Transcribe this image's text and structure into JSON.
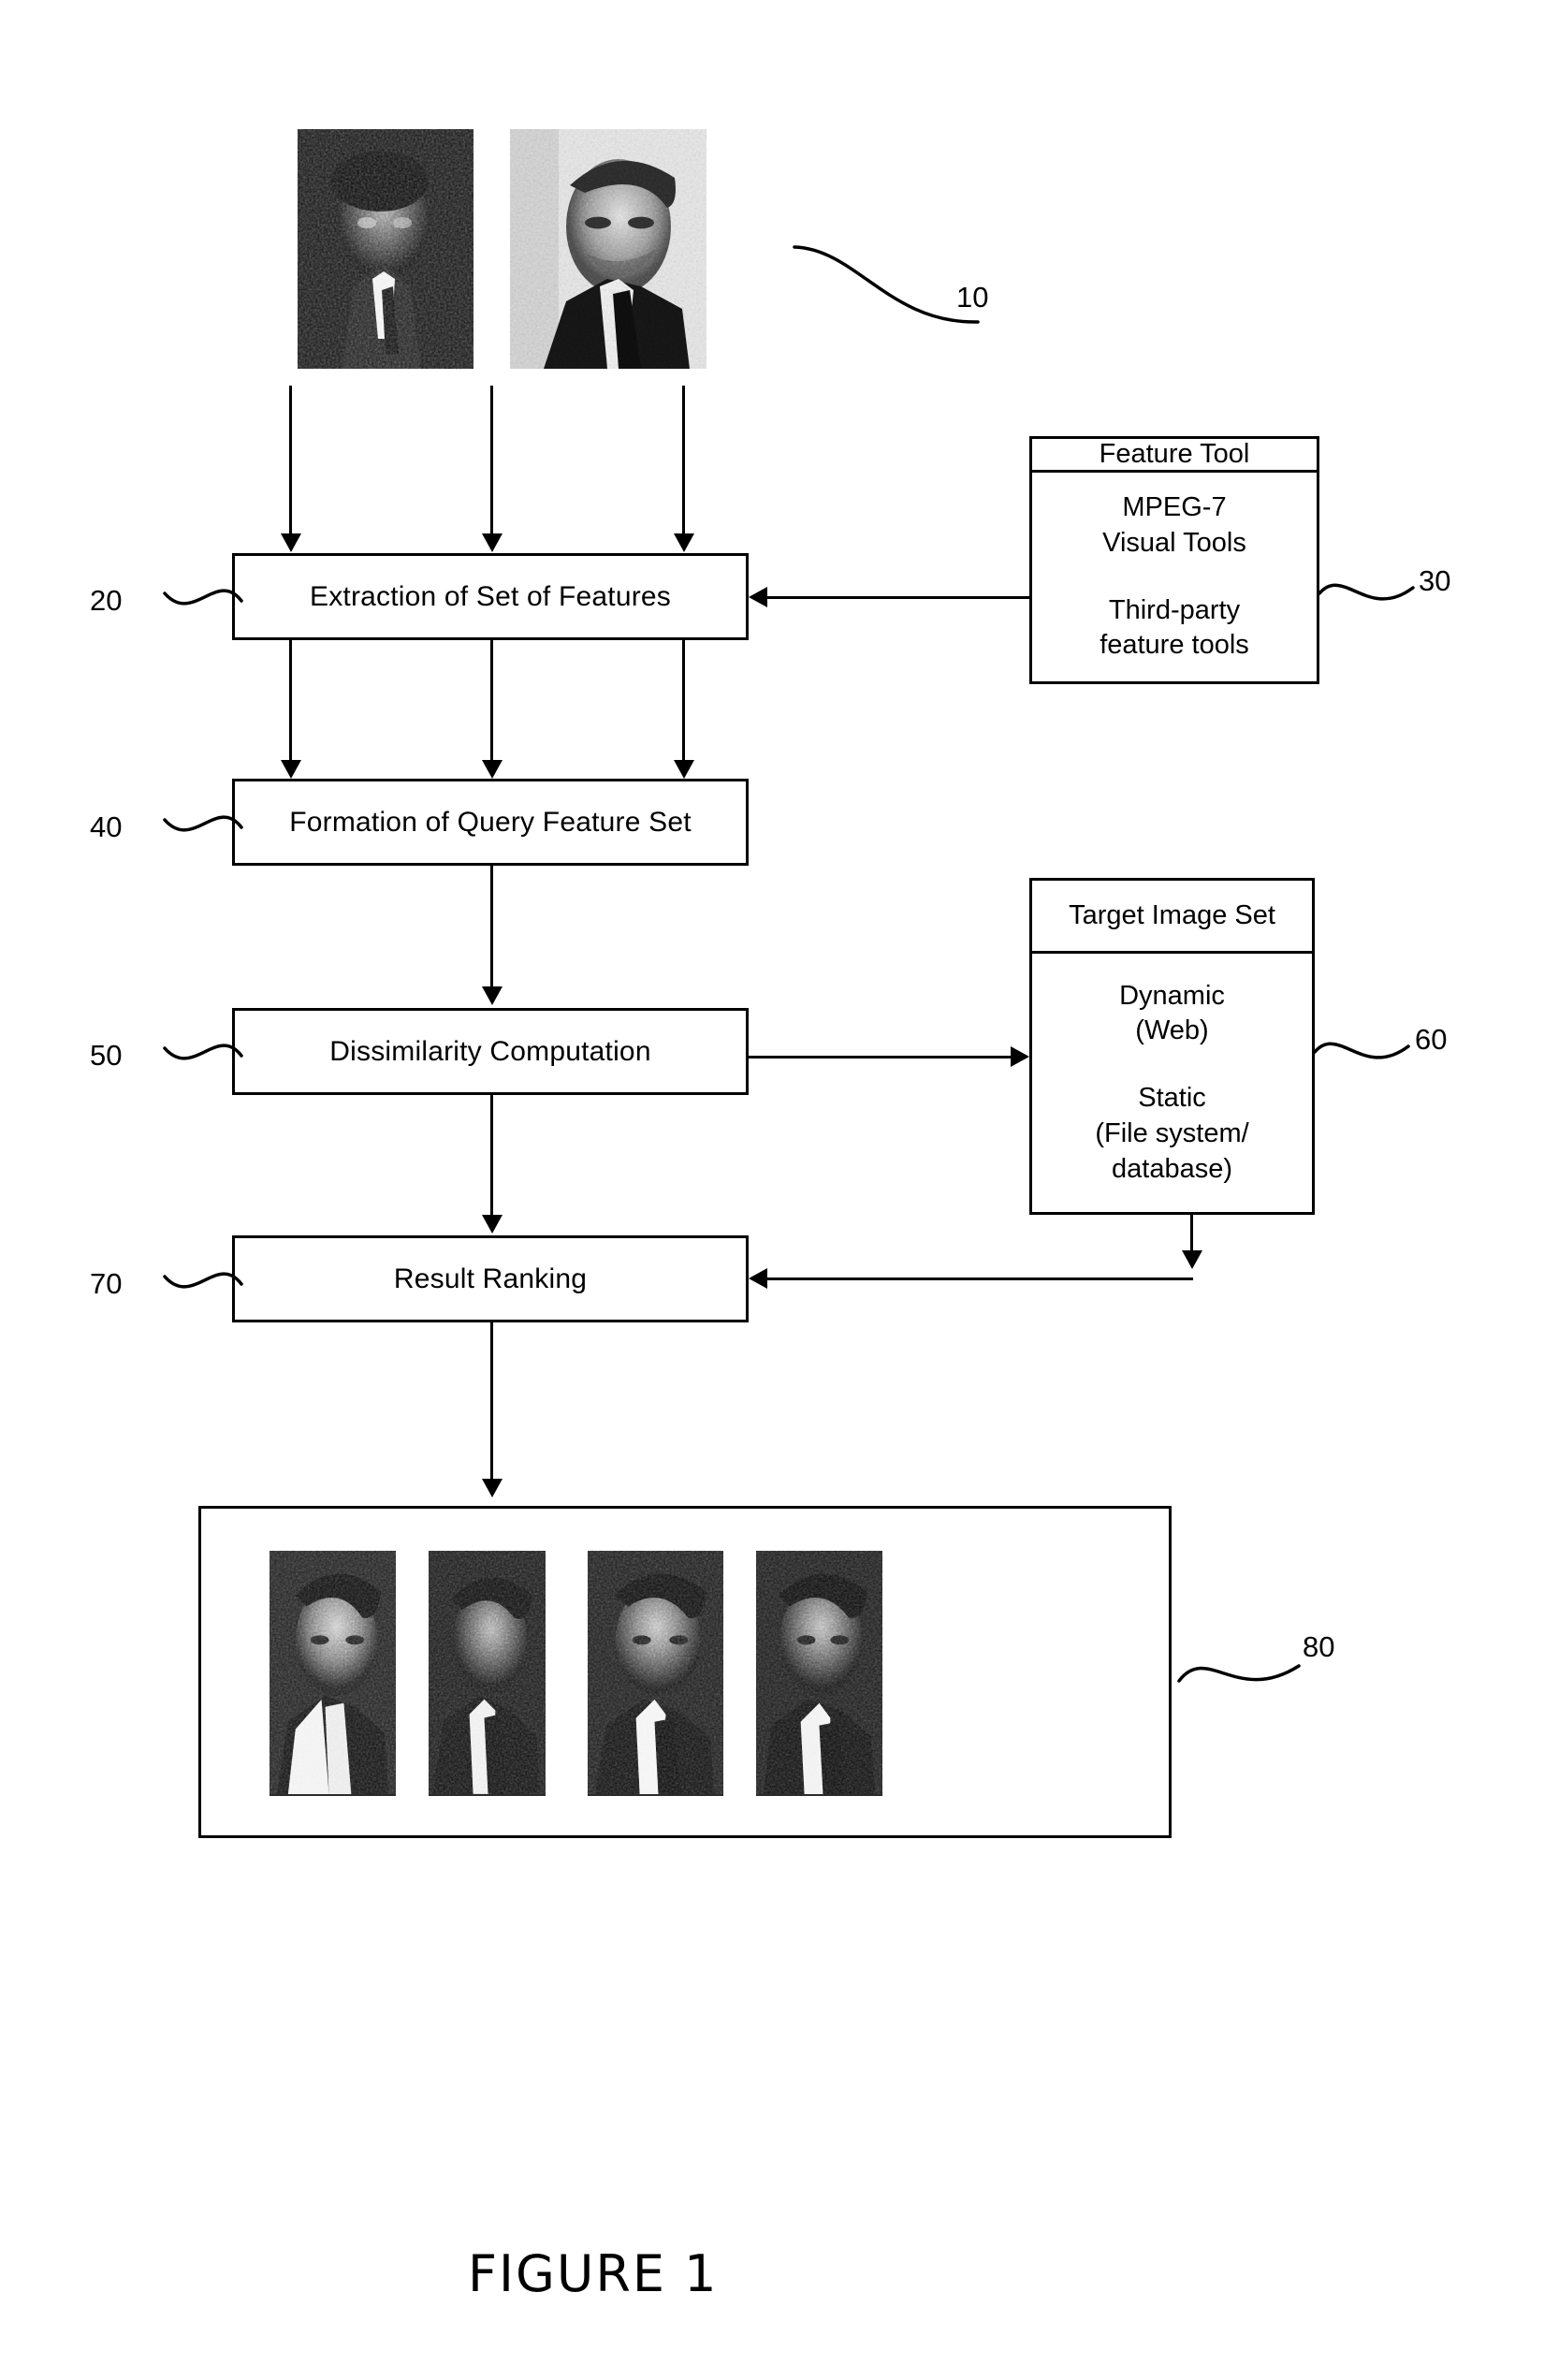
{
  "figure": {
    "caption": "FIGURE 1"
  },
  "reference_numerals": {
    "query_images": "10",
    "extraction": "20",
    "feature_tool": "30",
    "formation": "40",
    "dissimilarity": "50",
    "target_image_set": "60",
    "result_ranking": "70",
    "results_panel": "80"
  },
  "process_boxes": [
    {
      "id": "extraction",
      "label": "Extraction of Set of Features"
    },
    {
      "id": "formation",
      "label": "Formation of Query Feature Set"
    },
    {
      "id": "dissimilarity",
      "label": "Dissimilarity Computation"
    },
    {
      "id": "result_ranking",
      "label": "Result Ranking"
    }
  ],
  "feature_tool": {
    "title": "Feature Tool",
    "items": [
      "MPEG-7\nVisual Tools",
      "Third-party\nfeature tools"
    ],
    "item1_line1": "MPEG-7",
    "item1_line2": "Visual Tools",
    "item2_line1": "Third-party",
    "item2_line2": "feature tools"
  },
  "target_image_set": {
    "title": "Target Image Set",
    "item1_line1": "Dynamic",
    "item1_line2": "(Web)",
    "item2_line1": "Static",
    "item2_line2": "(File system/",
    "item2_line3": "database)"
  },
  "query_images": {
    "count": 2,
    "description": "two grayscale halftone portrait photographs used as the query"
  },
  "result_images": {
    "count": 4,
    "description": "four ranked grayscale halftone portrait thumbnails"
  },
  "colors": {
    "ink": "#000000",
    "paper": "#ffffff"
  }
}
